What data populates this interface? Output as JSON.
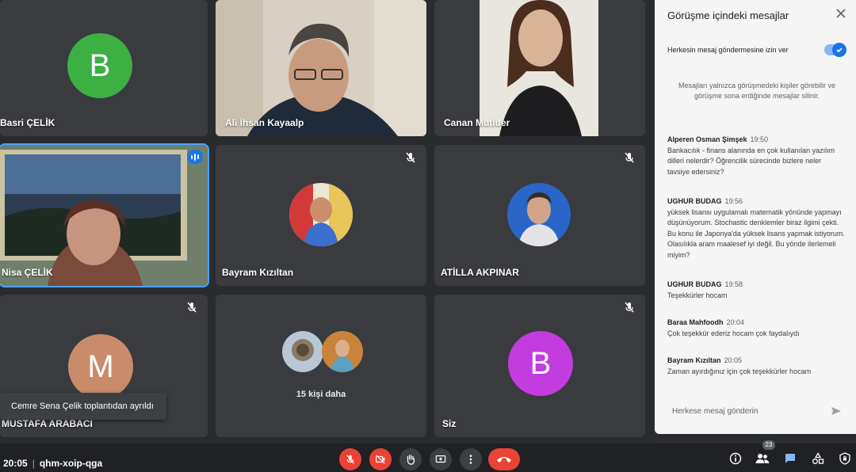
{
  "tiles": {
    "basri": {
      "name": "Basri ÇELİK",
      "initial": "B",
      "color": "#3cb043"
    },
    "ali": {
      "name": "Ali İhsan Kayaalp"
    },
    "canan": {
      "name": "Canan Mutluer"
    },
    "nisa": {
      "name": "Nisa ÇELİK"
    },
    "bayram": {
      "name": "Bayram Kızıltan"
    },
    "atilla": {
      "name": "ATİLLA AKPINAR"
    },
    "mustafa": {
      "name": "MUSTAFA ARABACI",
      "initial": "M",
      "color": "#c98c6a"
    },
    "more": {
      "label": "15 kişi daha"
    },
    "self": {
      "name": "Siz",
      "initial": "B",
      "color": "#c23ce0"
    }
  },
  "toast": "Cemre Sena Çelik toplantıdan ayrıldı",
  "chat": {
    "title": "Görüşme içindeki mesajlar",
    "permission_label": "Herkesin mesaj göndermesine izin ver",
    "notice": "Mesajları yalnızca görüşmedeki kişiler görebilir ve görüşme sona erdiğinde mesajlar silinir.",
    "messages": [
      {
        "sender": "Alperen Osman Şimşek",
        "time": "19:50",
        "text": "Bankacılık - finans alanında en çok kullanılan yazılım dilleri nelerdir? Öğrencilik sürecinde bizlere neler tavsiye edersiniz?"
      },
      {
        "sender": "UGHUR BUDAG",
        "time": "19:56",
        "text": "yüksek lisansı uygulamalı matematik yönünde yapmayı düşünüyorum. Stochastic denklemler biraz ilgimi çekti. Bu konu ile Japonya'da yüksek lisans yapmak istiyorum. Olasılıkla aram maalesef iyi değil. Bu yönde ilerlemeli miyim?"
      },
      {
        "sender": "UGHUR BUDAG",
        "time": "19:58",
        "text": "Teşekkürler hocam"
      },
      {
        "sender": "Baraa Mahfoodh",
        "time": "20:04",
        "text": "Çok teşekkür ederiz hocam çok faydalıydı"
      },
      {
        "sender": "Bayram Kızıltan",
        "time": "20:05",
        "text": "Zaman ayırdığınız için çok teşekkürler hocam"
      }
    ],
    "input_placeholder": "Herkese mesaj gönderin"
  },
  "bottom": {
    "time": "20:05",
    "meeting_code": "qhm-xoip-qga",
    "participant_count": "23"
  },
  "icons": {
    "mic": "mic-off-icon",
    "camera": "camera-off-icon",
    "hand": "raise-hand-icon",
    "present": "present-screen-icon",
    "more": "more-options-icon",
    "hangup": "hang-up-icon",
    "info": "info-icon",
    "people": "people-icon",
    "chat": "chat-icon",
    "activities": "activities-icon",
    "host": "host-controls-icon"
  },
  "colors": {
    "accent": "#1a73e8",
    "danger": "#ea4335"
  }
}
